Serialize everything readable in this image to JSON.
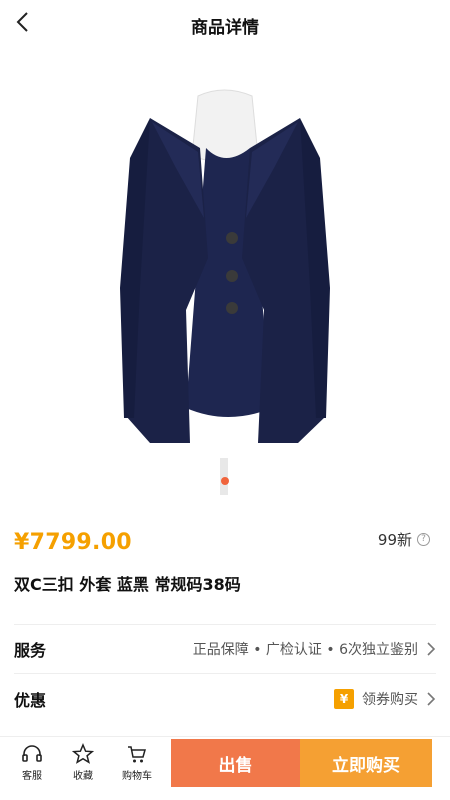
{
  "header": {
    "title": "商品详情"
  },
  "product": {
    "price": "¥7799.00",
    "condition": "99新",
    "name": "双C三扣 外套 蓝黑 常规码38码",
    "image_icon": "navy-tweed-jacket-on-mannequin"
  },
  "service": {
    "label": "服务",
    "value": "正品保障 • 广检认证 • 6次独立鉴别"
  },
  "promo": {
    "label": "优惠",
    "badge": "¥",
    "value": "领券购买"
  },
  "bottom": {
    "support_label": "客服",
    "favorite_label": "收藏",
    "cart_label": "购物车",
    "sell_label": "出售",
    "buy_label": "立即购买"
  },
  "colors": {
    "accent_orange": "#f5a000",
    "sell_button": "#f1784a",
    "buy_button": "#f5a033",
    "carousel_dot": "#f0643c"
  }
}
